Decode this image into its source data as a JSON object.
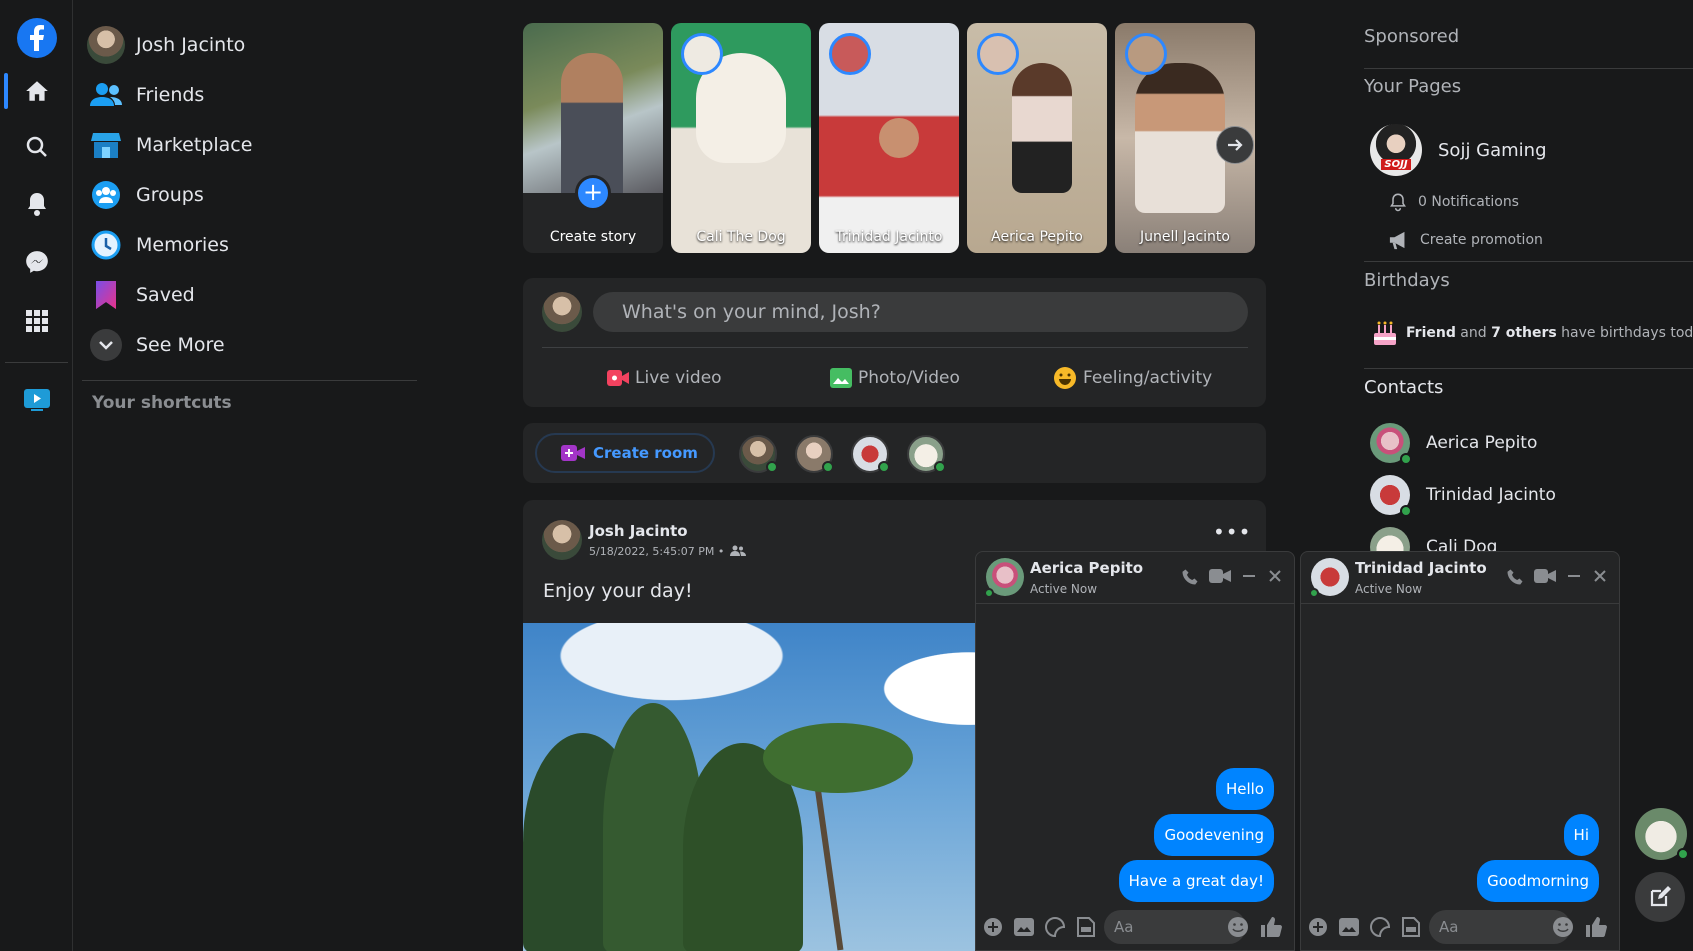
{
  "rail": {
    "items": [
      "facebook-logo",
      "home",
      "search",
      "notifications",
      "messenger",
      "menu",
      "watch"
    ]
  },
  "leftnav": {
    "profile_name": "Josh Jacinto",
    "items": [
      {
        "label": "Friends",
        "icon": "friends-icon"
      },
      {
        "label": "Marketplace",
        "icon": "marketplace-icon"
      },
      {
        "label": "Groups",
        "icon": "groups-icon"
      },
      {
        "label": "Memories",
        "icon": "memories-icon"
      },
      {
        "label": "Saved",
        "icon": "saved-icon"
      },
      {
        "label": "See More",
        "icon": "chevron-down-icon"
      }
    ],
    "shortcuts_title": "Your shortcuts"
  },
  "stories": [
    {
      "name": "Create story"
    },
    {
      "name": "Cali The Dog"
    },
    {
      "name": "Trinidad Jacinto"
    },
    {
      "name": "Aerica Pepito"
    },
    {
      "name": "Junell Jacinto"
    }
  ],
  "composer": {
    "placeholder": "What's on your mind, Josh?",
    "live_video": "Live video",
    "photo_video": "Photo/Video",
    "feeling": "Feeling/activity"
  },
  "rooms": {
    "create_room": "Create room"
  },
  "post": {
    "author": "Josh Jacinto",
    "timestamp": "5/18/2022, 5:45:07 PM",
    "separator": "•",
    "text": "Enjoy your day!",
    "more": "•••"
  },
  "right": {
    "sponsored": "Sponsored",
    "your_pages": "Your Pages",
    "page_name": "Sojj Gaming",
    "page_logo_text": "SOJJ",
    "notifications": "0 Notifications",
    "create_promotion": "Create promotion",
    "birthdays": "Birthdays",
    "birthday_friend": "Friend",
    "birthday_and": " and ",
    "birthday_others": "7 others",
    "birthday_rest": " have birthdays today.",
    "contacts_title": "Contacts",
    "contacts": [
      "Aerica Pepito",
      "Trinidad Jacinto",
      "Cali Dog"
    ]
  },
  "chats": [
    {
      "name": "Aerica Pepito",
      "status": "Active Now",
      "messages": [
        "Hello",
        "Goodevening",
        "Have a great day!"
      ],
      "input_placeholder": "Aa"
    },
    {
      "name": "Trinidad Jacinto",
      "status": "Active Now",
      "messages": [
        "Hi",
        "Goodmorning"
      ],
      "input_placeholder": "Aa"
    }
  ],
  "colors": {
    "accent": "#2d88ff",
    "bubble": "#0084ff",
    "online": "#31a24c",
    "surface": "#242526",
    "background": "#18191a"
  }
}
